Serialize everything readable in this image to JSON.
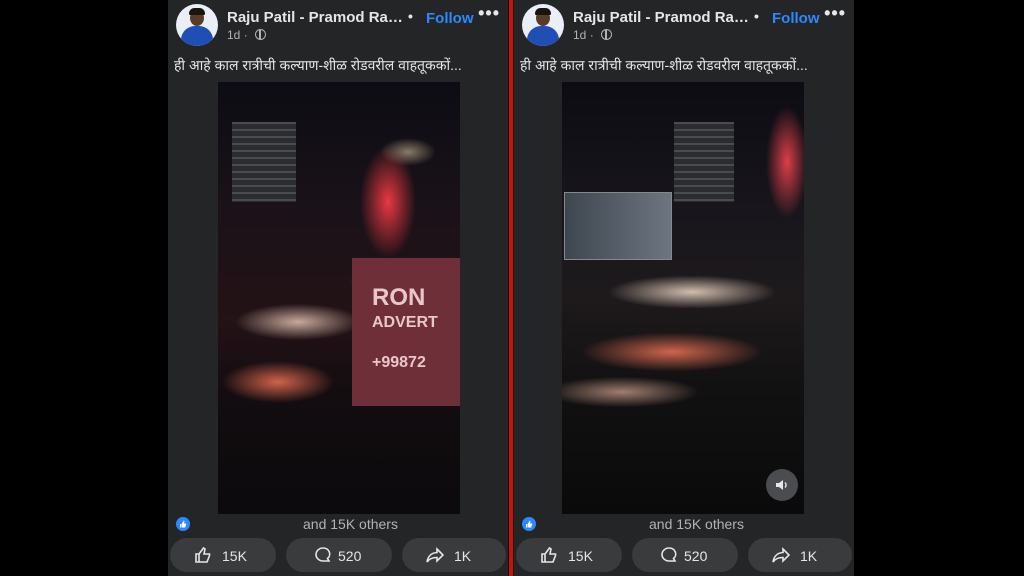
{
  "posts": [
    {
      "author": "Raju Patil - Pramod Ratan Patil",
      "follow_label": "Follow",
      "separator": "•",
      "more_label": "•••",
      "time": "1d",
      "caption": "ही आहे काल रात्रीची कल्याण-शीळ रोडवरील वाहतूककों...",
      "billboard": [
        "RON",
        "ADVERT",
        "+99872"
      ],
      "reaction_text": "and 15K others",
      "like_count": "15K",
      "comment_count": "520",
      "share_count": "1K"
    },
    {
      "author": "Raju Patil - Pramod Ratan Patil",
      "follow_label": "Follow",
      "separator": "•",
      "more_label": "•••",
      "time": "1d",
      "caption": "ही आहे काल रात्रीची कल्याण-शीळ रोडवरील वाहतूककों...",
      "reaction_text": "and 15K others",
      "like_count": "15K",
      "comment_count": "520",
      "share_count": "1K"
    }
  ],
  "colors": {
    "panel_bg": "#242526",
    "accent": "#2d88ff",
    "divider": "#d00d0d"
  },
  "icons": [
    "globe-icon",
    "like-icon",
    "comment-icon",
    "share-icon",
    "volume-icon",
    "more-icon"
  ]
}
